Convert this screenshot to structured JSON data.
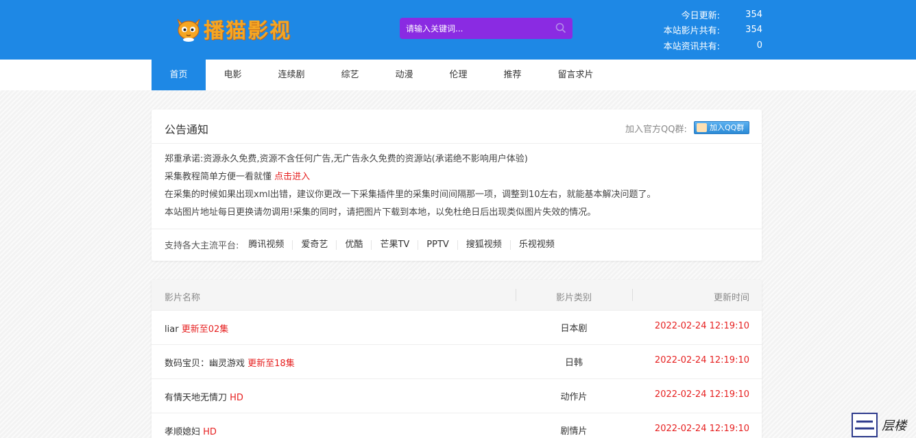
{
  "site": {
    "logo_text": "播猫影视"
  },
  "search": {
    "placeholder": "请输入关键词..."
  },
  "stats": [
    {
      "label": "今日更新:",
      "value": "354"
    },
    {
      "label": "本站影片共有:",
      "value": "354"
    },
    {
      "label": "本站资讯共有:",
      "value": "0"
    }
  ],
  "nav": [
    {
      "label": "首页",
      "active": true
    },
    {
      "label": "电影"
    },
    {
      "label": "连续剧"
    },
    {
      "label": "综艺"
    },
    {
      "label": "动漫"
    },
    {
      "label": "伦理"
    },
    {
      "label": "推荐"
    },
    {
      "label": "留言求片"
    }
  ],
  "notice": {
    "title": "公告通知",
    "qq_label": "加入官方QQ群:",
    "qq_button": "加入QQ群",
    "lines": [
      {
        "text": "郑重承诺:资源永久免费,资源不含任何广告,无广告永久免费的资源站(承诺绝不影响用户体验)",
        "link": ""
      },
      {
        "text": "采集教程简单方便一看就懂 ",
        "link": "点击进入"
      },
      {
        "text": "在采集的时候如果出现xml出错，建议你更改一下采集插件里的采集时间间隔那一项，调整到10左右，就能基本解决问题了。",
        "link": ""
      },
      {
        "text": "本站图片地址每日更换请勿调用!采集的同时，请把图片下载到本地，以免杜绝日后出现类似图片失效的情况。",
        "link": ""
      }
    ],
    "platforms_label": "支持各大主流平台:",
    "platforms": [
      "腾讯视频",
      "爱奇艺",
      "优酷",
      "芒果TV",
      "PPTV",
      "搜狐视频",
      "乐视视频"
    ]
  },
  "list": {
    "headers": {
      "name": "影片名称",
      "type": "影片类别",
      "time": "更新时间"
    },
    "rows": [
      {
        "name": "liar",
        "tag": "更新至02集",
        "type": "日本剧",
        "time": "2022-02-24 12:19:10"
      },
      {
        "name": "数码宝贝：幽灵游戏",
        "tag": "更新至18集",
        "type": "日韩",
        "time": "2022-02-24 12:19:10"
      },
      {
        "name": "有情天地无情刀",
        "tag": "HD",
        "type": "动作片",
        "time": "2022-02-24 12:19:10"
      },
      {
        "name": "孝顺媳妇",
        "tag": "HD",
        "type": "剧情片",
        "time": "2022-02-24 12:19:10"
      }
    ]
  },
  "watermark": {
    "text": "层楼"
  },
  "colors": {
    "primary": "#1e88e5",
    "search_bg": "#8a2be2",
    "accent_red": "#e61f1f",
    "logo_orange": "#f5a623"
  }
}
